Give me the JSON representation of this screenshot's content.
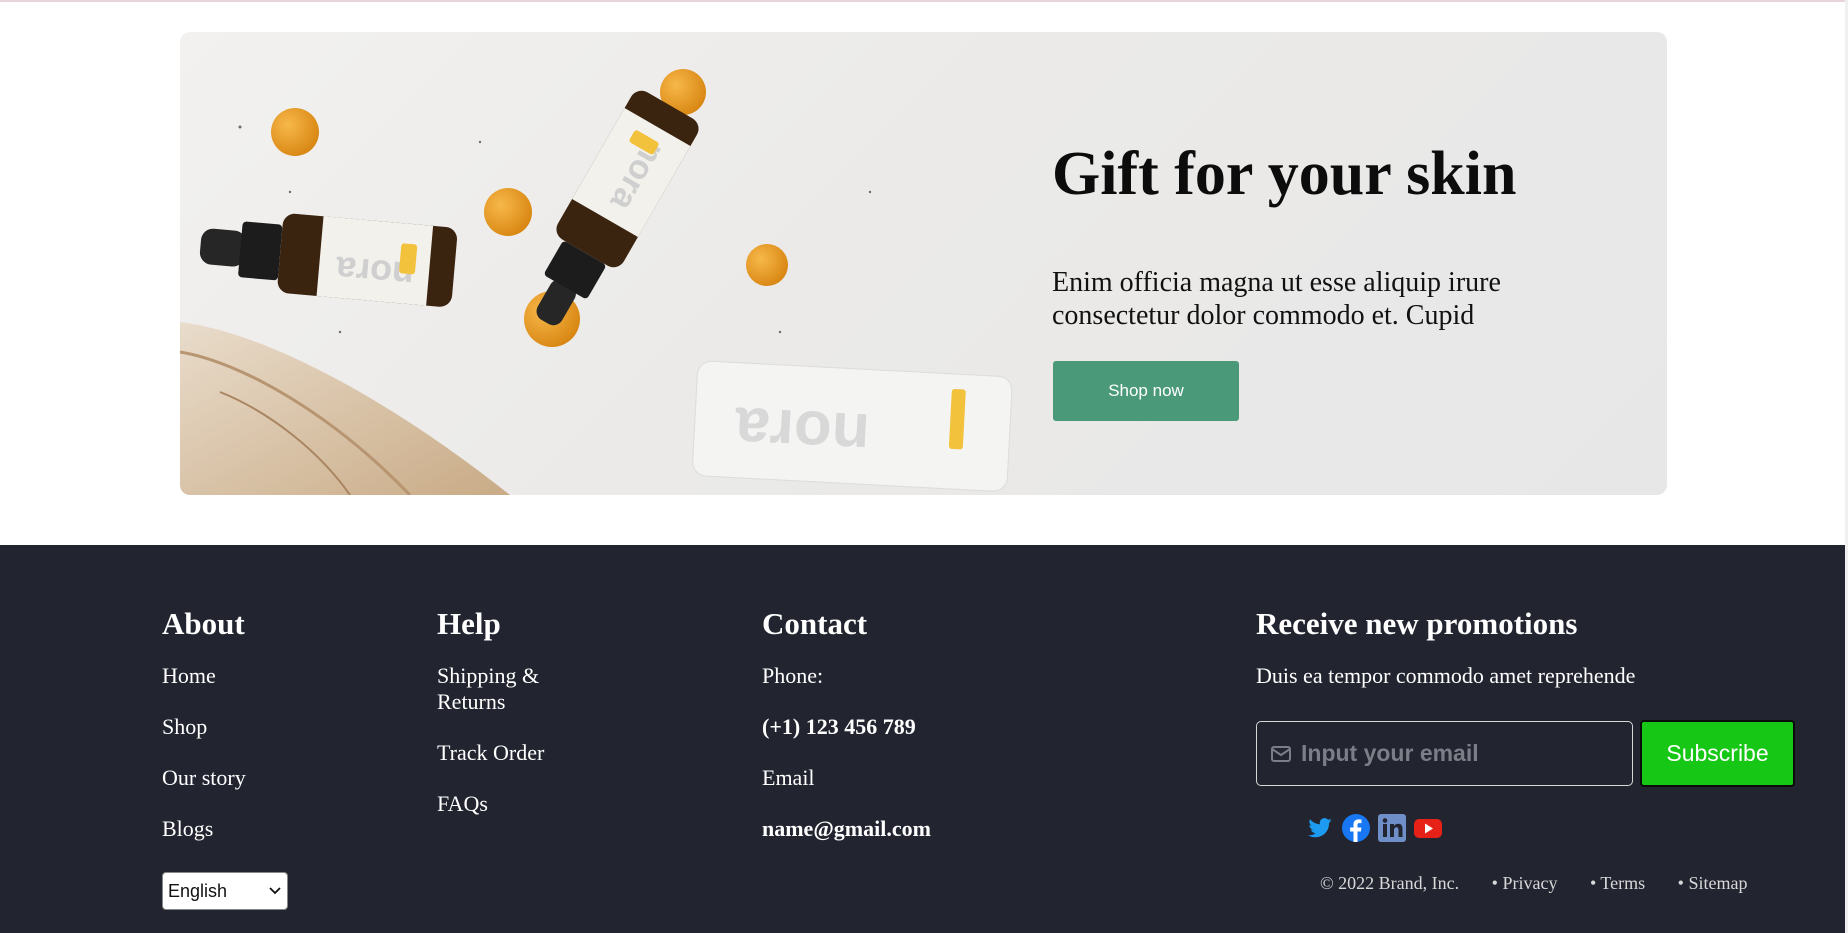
{
  "hero": {
    "title": "Gift for your skin",
    "subtitle": "Enim officia magna ut esse aliquip irure consectetur dolor commodo et. Cupid",
    "button_label": "Shop now",
    "product_brand": "nora"
  },
  "footer": {
    "about": {
      "heading": "About",
      "links": [
        "Home",
        "Shop",
        "Our story",
        "Blogs"
      ]
    },
    "help": {
      "heading": "Help",
      "links": [
        "Shipping & Returns",
        "Track Order",
        "FAQs"
      ]
    },
    "contact": {
      "heading": "Contact",
      "phone_label": "Phone:",
      "phone": "(+1) 123 456 789",
      "email_label": "Email",
      "email": "name@gmail.com"
    },
    "promo": {
      "heading": "Receive new promotions",
      "text": "Duis ea tempor commodo amet reprehende",
      "email_placeholder": "Input your email",
      "subscribe_label": "Subscribe"
    },
    "language": {
      "selected": "English"
    },
    "socials": [
      "twitter-icon",
      "facebook-icon",
      "linkedin-icon",
      "youtube-icon"
    ],
    "legal": {
      "copyright": "© 2022 Brand, Inc.",
      "privacy": "• Privacy",
      "terms": "• Terms",
      "sitemap": "• Sitemap"
    }
  },
  "colors": {
    "accent": "#4a9a7a",
    "footer_bg": "#222430",
    "subscribe": "#16c716"
  }
}
